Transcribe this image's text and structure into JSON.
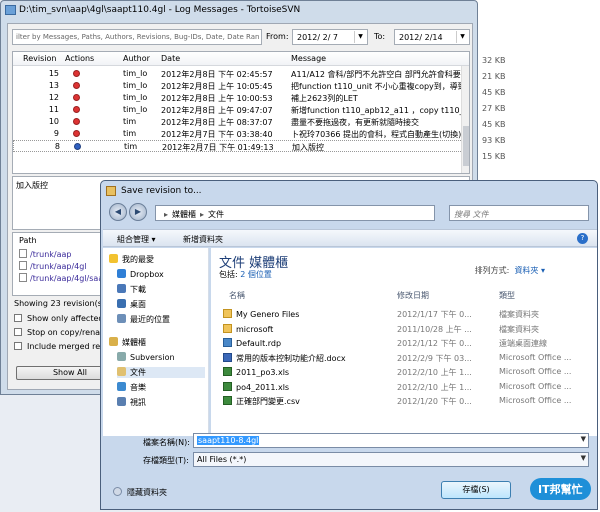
{
  "background": {
    "sizes": [
      "32 KB",
      "21 KB",
      "45 KB",
      "27 KB",
      "45 KB",
      "93 KB",
      "15 KB"
    ]
  },
  "log_window": {
    "title": "D:\\tim_svn\\aap\\4gl\\saapt110.4gl - Log Messages - TortoiseSVN",
    "filter_placeholder": "ilter by Messages, Paths, Authors, Revisions, Bug-IDs, Date, Date Ran",
    "from_label": "From:",
    "from_value": "2012/ 2/ 7",
    "to_label": "To:",
    "to_value": "2012/ 2/14",
    "columns": [
      "Revision",
      "Actions",
      "Author",
      "Date",
      "Message"
    ],
    "rows": [
      {
        "revision": "15",
        "action": "del",
        "author": "tim_lo",
        "date": "2012年2月8日 下午 02:45:57",
        "message": "A11/A12 會科/部門不允許空白 部門允許會科要允"
      },
      {
        "revision": "13",
        "action": "del",
        "author": "tim_lo",
        "date": "2012年2月8日 上午 10:05:45",
        "message": "把function t110_unit 不小心重複copy到，導致兩"
      },
      {
        "revision": "12",
        "action": "del",
        "author": "tim_lo",
        "date": "2012年2月8日 上午 10:00:53",
        "message": "補上2623列的LET"
      },
      {
        "revision": "11",
        "action": "del",
        "author": "tim_lo",
        "date": "2012年2月8日 上午 09:47:07",
        "message": "新增function t110_apb12_a11 ，copy t110_apb12"
      },
      {
        "revision": "10",
        "action": "del",
        "author": "tim",
        "date": "2012年2月8日 上午 08:37:07",
        "message": "盡量不要拖過夜，有更新就隨時接交"
      },
      {
        "revision": "9",
        "action": "del",
        "author": "tim",
        "date": "2012年2月7日 下午 03:38:40",
        "message": "卜祝玲70366 提出的會科，程式自動產生(切換)"
      },
      {
        "revision": "8",
        "action": "add",
        "author": "tim",
        "date": "2012年2月7日 下午 01:49:13",
        "message": "加入版控"
      }
    ],
    "message_text": "加入版控",
    "path_header": "Path",
    "paths": [
      "/trunk/aap",
      "/trunk/aap/4gl",
      "/trunk/aap/4gl/saapt"
    ],
    "status": "Showing 23 revision(s), fr",
    "options": [
      "Show only affected pa",
      "Stop on copy/rename",
      "Include merged revisio"
    ],
    "show_all": "Show All"
  },
  "save_dialog": {
    "title": "Save revision to...",
    "address": [
      "媒體櫃",
      "文件"
    ],
    "search_placeholder": "搜尋 文件",
    "organize": "組合管理 ▾",
    "new_folder": "新增資料夾",
    "sidebar": [
      {
        "label": "我的最愛",
        "icon": "star-icon",
        "group": true
      },
      {
        "label": "Dropbox",
        "icon": "dropbox-icon"
      },
      {
        "label": "下載",
        "icon": "download-icon"
      },
      {
        "label": "桌面",
        "icon": "desktop-icon"
      },
      {
        "label": "最近的位置",
        "icon": "recent-icon"
      },
      {
        "label": "媒體櫃",
        "icon": "library-icon",
        "group": true
      },
      {
        "label": "Subversion",
        "icon": "subversion-icon"
      },
      {
        "label": "文件",
        "icon": "documents-icon",
        "selected": true
      },
      {
        "label": "音樂",
        "icon": "music-icon"
      },
      {
        "label": "視訊",
        "icon": "video-icon"
      }
    ],
    "library_title": "文件 媒體櫃",
    "includes_label": "包括:",
    "includes_link": "2 個位置",
    "arrange_label": "排列方式:",
    "arrange_value": "資料夾 ▾",
    "file_columns": [
      "名稱",
      "修改日期",
      "類型"
    ],
    "files": [
      {
        "name": "My Genero Files",
        "date": "2012/1/17 下午 0...",
        "type": "檔案資料夾",
        "kind": "folder"
      },
      {
        "name": "microsoft",
        "date": "2011/10/28 上午 ...",
        "type": "檔案資料夾",
        "kind": "folder"
      },
      {
        "name": "Default.rdp",
        "date": "2012/1/12 下午 0...",
        "type": "遠端桌面連線",
        "kind": "rdp"
      },
      {
        "name": "常用的版本控制功能介紹.docx",
        "date": "2012/2/9 下午 03...",
        "type": "Microsoft Office ...",
        "kind": "doc"
      },
      {
        "name": "2011_po3.xls",
        "date": "2012/2/10 上午 1...",
        "type": "Microsoft Office ...",
        "kind": "xls"
      },
      {
        "name": "po4_2011.xls",
        "date": "2012/2/10 上午 1...",
        "type": "Microsoft Office ...",
        "kind": "xls"
      },
      {
        "name": "正確部門變更.csv",
        "date": "2012/1/20 下午 0...",
        "type": "Microsoft Office ...",
        "kind": "xls"
      }
    ],
    "filename_label": "檔案名稱(N):",
    "filename_value": "saapt110-8.4gl",
    "filetype_label": "存檔類型(T):",
    "filetype_value": "All Files (*.*)",
    "hide_folders": "隱藏資料夾",
    "save_button": "存檔(S)"
  },
  "watermark": "IT邦幫忙"
}
